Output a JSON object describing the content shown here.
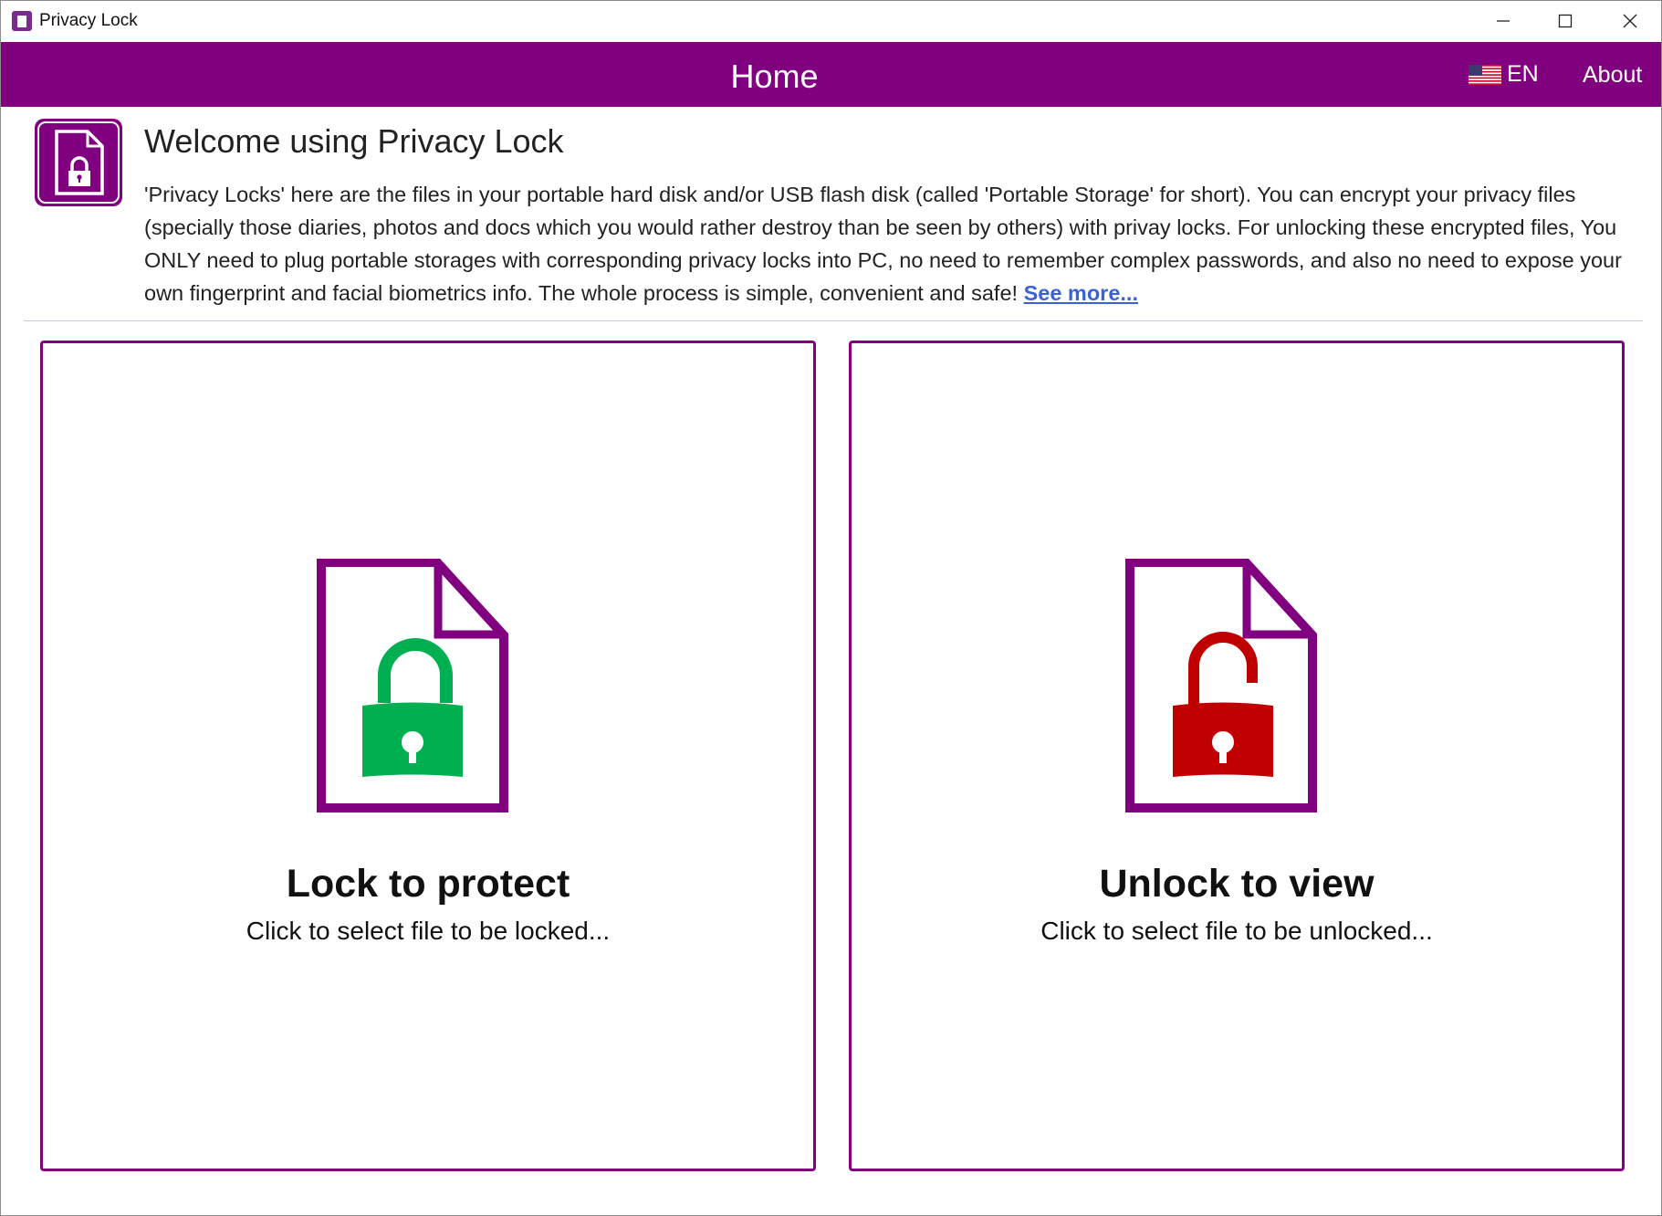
{
  "window": {
    "title": "Privacy Lock",
    "icons": {
      "app": "privacy-lock-app-icon",
      "minimize": "minimize-icon",
      "maximize": "maximize-icon",
      "close": "close-icon"
    }
  },
  "header": {
    "title": "Home",
    "language": {
      "flag_icon": "us-flag-icon",
      "label": "EN"
    },
    "about_label": "About",
    "background": "#800080"
  },
  "welcome": {
    "logo_icon": "locked-file-icon",
    "title": "Welcome using Privacy Lock",
    "description": "'Privacy Locks' here are the files in your portable hard disk and/or USB flash disk (called 'Portable Storage' for short). You can encrypt your privacy files (specially those diaries, photos and docs which you would rather destroy than be seen by others) with privay locks. For unlocking these encrypted files, You ONLY need to plug portable storages with corresponding privacy locks into PC, no need to remember complex passwords, and also no need to expose your own fingerprint and facial biometrics info. The whole process is simple, convenient and safe!",
    "see_more_label": "See more...",
    "link_color": "#3a62d8"
  },
  "actions": {
    "lock": {
      "icon": "file-locked-green-padlock-icon",
      "title": "Lock to protect",
      "subtitle": "Click to select file to be locked...",
      "padlock_color": "#00b050"
    },
    "unlock": {
      "icon": "file-unlocked-red-padlock-icon",
      "title": "Unlock to view",
      "subtitle": "Click to select file to be unlocked...",
      "padlock_color": "#c00000"
    },
    "frame_color": "#800080"
  }
}
